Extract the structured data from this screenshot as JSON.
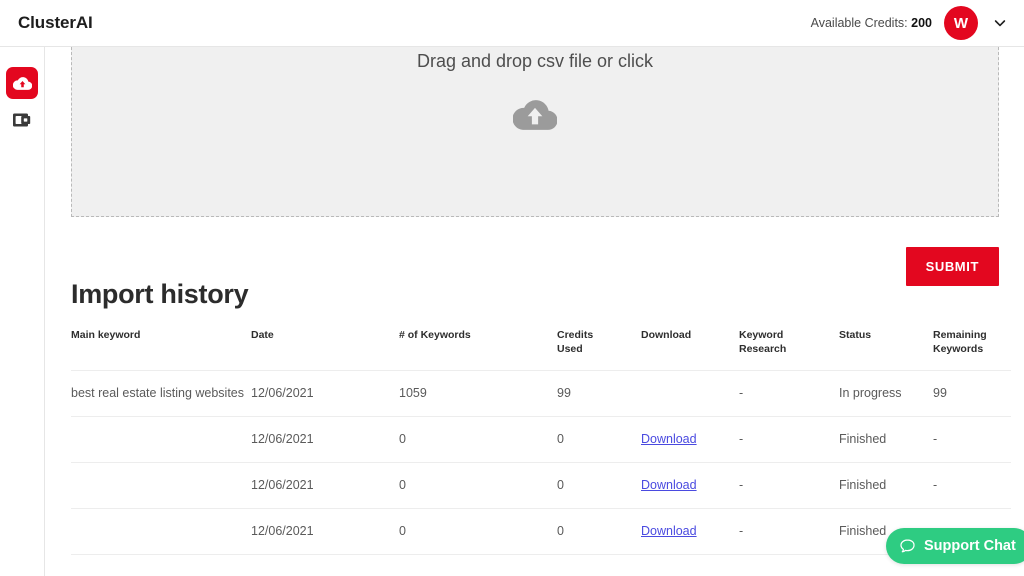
{
  "header": {
    "brand": "ClusterAI",
    "credits_label": "Available Credits:",
    "credits_value": "200",
    "avatar_initial": "W",
    "chevron_icon": "chevron-down-icon",
    "accent_color": "#e3071f"
  },
  "sidebar": {
    "items": [
      {
        "icon": "cloud-upload-icon",
        "active": true
      },
      {
        "icon": "wallet-icon",
        "active": false
      }
    ]
  },
  "dropzone": {
    "text": "Drag and drop csv file or click",
    "icon": "cloud-upload-icon",
    "background": "#f0f0f0",
    "border_color": "#b9b9b9"
  },
  "actions": {
    "submit_label": "SUBMIT"
  },
  "import_history": {
    "title": "Import history",
    "columns": [
      "Main keyword",
      "Date",
      "# of Keywords",
      "Credits\nUsed",
      "Download",
      "Keyword\nResearch",
      "Status",
      "Remaining\nKeywords"
    ],
    "columns_display": {
      "keyword": "Main keyword",
      "date": "Date",
      "num_keywords": "# of Keywords",
      "credits_used_l1": "Credits",
      "credits_used_l2": "Used",
      "download": "Download",
      "research_l1": "Keyword",
      "research_l2": "Research",
      "status": "Status",
      "remaining_l1": "Remaining",
      "remaining_l2": "Keywords"
    },
    "rows": [
      {
        "keyword": "best real estate listing websites",
        "date": "12/06/2021",
        "num_keywords": "1059",
        "credits_used": "99",
        "download": "",
        "keyword_research": "-",
        "status": "In progress",
        "remaining_keywords": "99"
      },
      {
        "keyword": "",
        "date": "12/06/2021",
        "num_keywords": "0",
        "credits_used": "0",
        "download": "Download",
        "keyword_research": "-",
        "status": "Finished",
        "remaining_keywords": "-"
      },
      {
        "keyword": "",
        "date": "12/06/2021",
        "num_keywords": "0",
        "credits_used": "0",
        "download": "Download",
        "keyword_research": "-",
        "status": "Finished",
        "remaining_keywords": "-"
      },
      {
        "keyword": "",
        "date": "12/06/2021",
        "num_keywords": "0",
        "credits_used": "0",
        "download": "Download",
        "keyword_research": "-",
        "status": "Finished",
        "remaining_keywords": "-"
      }
    ],
    "link_color": "#4a4ae0"
  },
  "support_chat": {
    "label": "Support Chat",
    "icon": "chat-bubble-icon",
    "color": "#2ecc82"
  }
}
